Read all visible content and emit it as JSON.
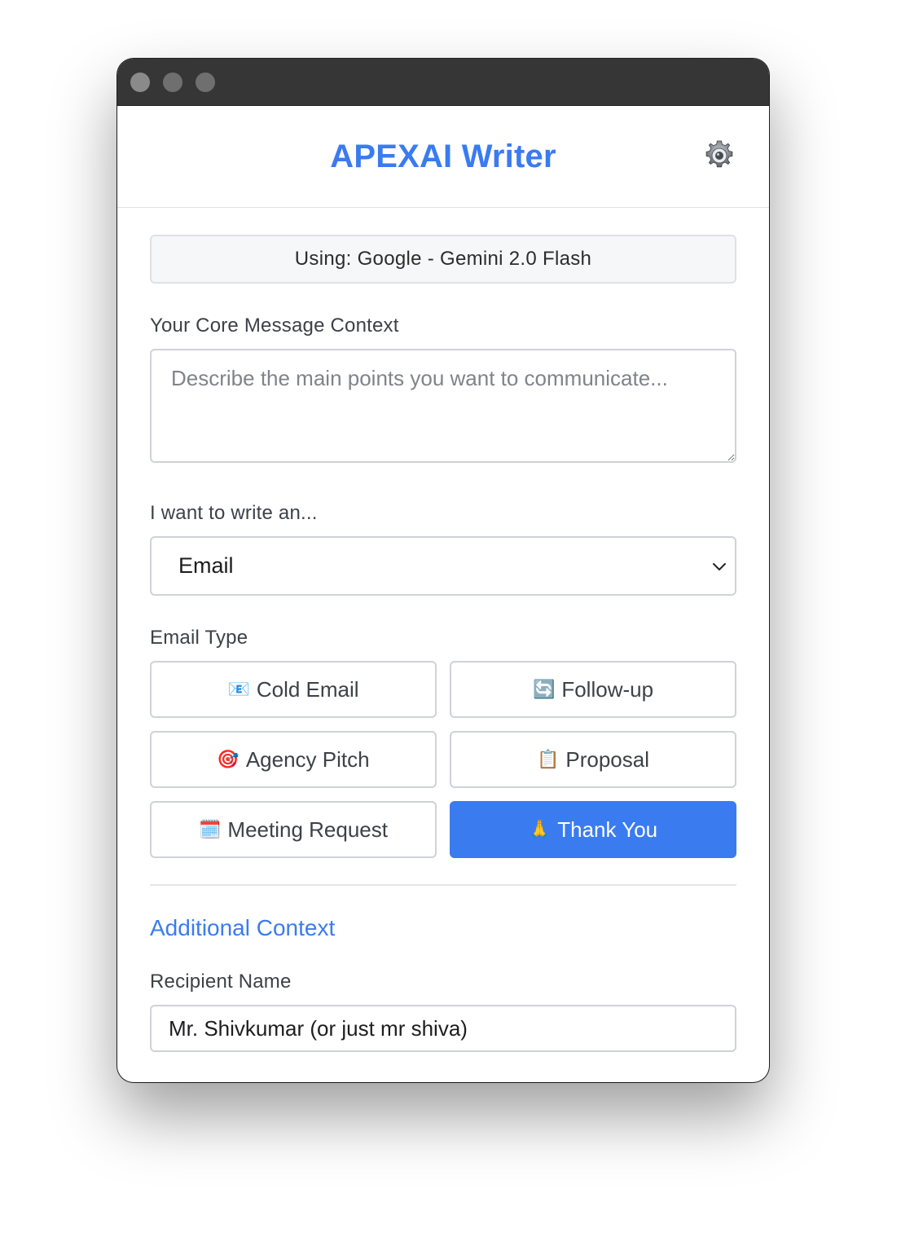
{
  "app": {
    "title": "APEXAI Writer",
    "accent_color": "#3a7bf0"
  },
  "header": {
    "settings_icon": "gear-icon"
  },
  "model": {
    "label": "Using: Google - Gemini 2.0 Flash"
  },
  "context": {
    "label": "Your Core Message Context",
    "placeholder": "Describe the main points you want to communicate...",
    "value": ""
  },
  "write_type": {
    "label": "I want to write an...",
    "selected": "Email"
  },
  "email_type": {
    "label": "Email Type",
    "options": [
      {
        "icon": "📧",
        "label": "Cold Email",
        "active": false
      },
      {
        "icon": "🔄",
        "label": "Follow-up",
        "active": false
      },
      {
        "icon": "🎯",
        "label": "Agency Pitch",
        "active": false
      },
      {
        "icon": "📋",
        "label": "Proposal",
        "active": false
      },
      {
        "icon": "🗓️",
        "label": "Meeting Request",
        "active": false
      },
      {
        "icon": "🙏",
        "label": "Thank You",
        "active": true
      }
    ]
  },
  "additional": {
    "title": "Additional Context",
    "recipient_label": "Recipient Name",
    "recipient_value": "Mr. Shivkumar (or just mr shiva)"
  }
}
